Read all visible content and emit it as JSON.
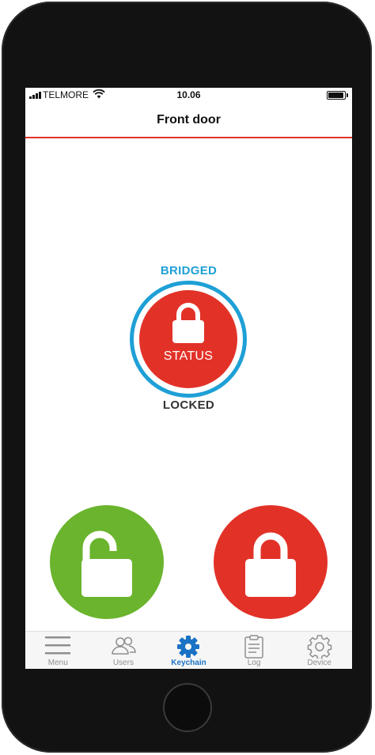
{
  "status_bar": {
    "carrier": "TELMORE",
    "time": "10.06"
  },
  "header": {
    "title": "Front door"
  },
  "lock_status": {
    "connection": "BRIDGED",
    "button_label": "STATUS",
    "state": "LOCKED"
  },
  "tabs": [
    {
      "label": "Menu",
      "icon": "menu-icon",
      "active": false
    },
    {
      "label": "Users",
      "icon": "users-icon",
      "active": false
    },
    {
      "label": "Keychain",
      "icon": "gear-icon",
      "active": true
    },
    {
      "label": "Log",
      "icon": "clipboard-icon",
      "active": false
    },
    {
      "label": "Device",
      "icon": "gear-outline-icon",
      "active": false
    }
  ],
  "colors": {
    "accent_red": "#e23228",
    "bridge_blue": "#1ea0d6",
    "unlock_green": "#6bb42d",
    "active_tab": "#1a72c4",
    "inactive_tab": "#8e8e8e"
  }
}
